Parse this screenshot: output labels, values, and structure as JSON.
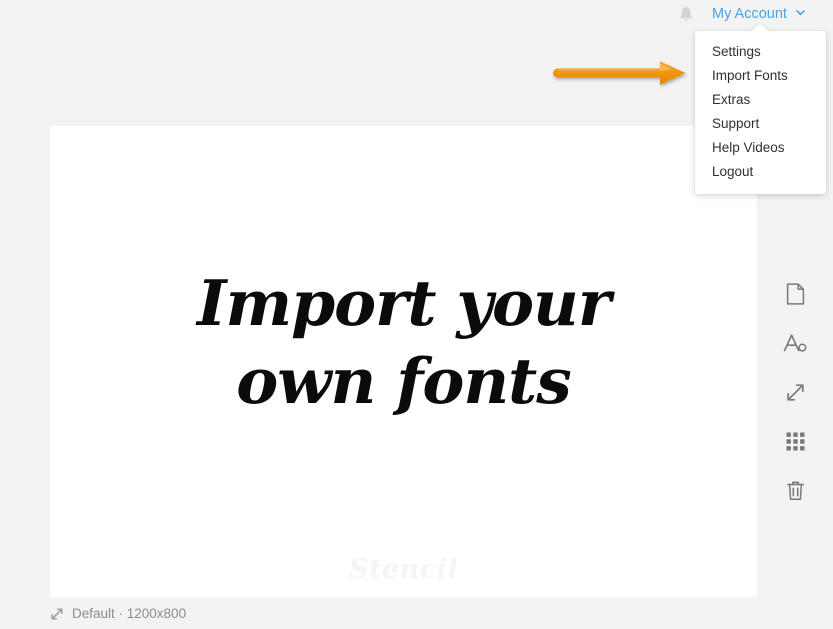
{
  "topbar": {
    "notifications_icon": "bell-icon",
    "account_label": "My Account",
    "account_chevron_icon": "chevron-down-icon"
  },
  "account_dropdown": {
    "items": [
      {
        "label": "Settings",
        "name": "settings"
      },
      {
        "label": "Import Fonts",
        "name": "import-fonts"
      },
      {
        "label": "Extras",
        "name": "extras"
      },
      {
        "label": "Support",
        "name": "support"
      },
      {
        "label": "Help Videos",
        "name": "help-videos"
      },
      {
        "label": "Logout",
        "name": "logout"
      }
    ]
  },
  "annotation": {
    "arrow_icon": "right-arrow-annotation",
    "arrow_color": "#f2960b",
    "arrow_color_dark": "#d97d05"
  },
  "canvas": {
    "headline": "Import your\nown fonts",
    "headline_color": "#0b0b0b",
    "watermark": "Stencil",
    "background": "#ffffff"
  },
  "tool_sidebar": {
    "tools": [
      {
        "name": "page-icon",
        "label": "Page"
      },
      {
        "name": "text-icon",
        "label": "Text"
      },
      {
        "name": "resize-icon",
        "label": "Resize"
      },
      {
        "name": "grid-icon",
        "label": "Grid"
      },
      {
        "name": "trash-icon",
        "label": "Delete"
      }
    ]
  },
  "statusbar": {
    "size_icon": "resize-diagonal-icon",
    "size_label": "Default · 1200x800"
  },
  "theme": {
    "page_background": "#f3f3f3",
    "accent_blue": "#49a3e3",
    "text_dark": "#2e3033",
    "text_muted": "#8d8d8d"
  }
}
